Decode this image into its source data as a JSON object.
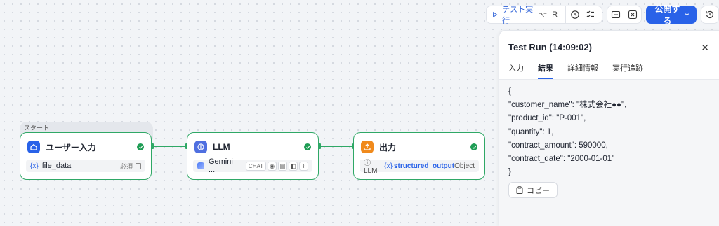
{
  "toolbar": {
    "test_run_label": "テスト実行",
    "test_run_shortcut_1": "⌥",
    "test_run_shortcut_2": "R",
    "publish_label": "公開する"
  },
  "canvas": {
    "start_label": "スタート",
    "nodes": [
      {
        "title": "ユーザー入力",
        "var_prefix": "{x}",
        "var": "file_data",
        "required": "必須"
      },
      {
        "title": "LLM",
        "model": "Gemini ...",
        "tags": [
          "CHAT"
        ]
      },
      {
        "title": "出力",
        "source": "ⓘ LLM",
        "var_prefix": "{x}",
        "var": "structured_output",
        "type": "Object"
      }
    ]
  },
  "panel": {
    "title": "Test Run (14:09:02)",
    "tabs": [
      "入力",
      "結果",
      "詳細情報",
      "実行追跡"
    ],
    "active_tab": "結果",
    "result_lines": [
      "{",
      "\"customer_name\": \"株式会社●●\",",
      "\"product_id\": \"P-001\",",
      "\"quantity\": 1,",
      "\"contract_amount\": 590000,",
      "\"contract_date\": \"2000-01-01\"",
      "}"
    ],
    "copy_label": "コピー"
  },
  "colors": {
    "accent": "#2962e8",
    "success": "#2fa866",
    "user_input_icon": "#2962e8",
    "llm_icon": "#4f6fe0",
    "output_icon": "#f08a1c"
  }
}
